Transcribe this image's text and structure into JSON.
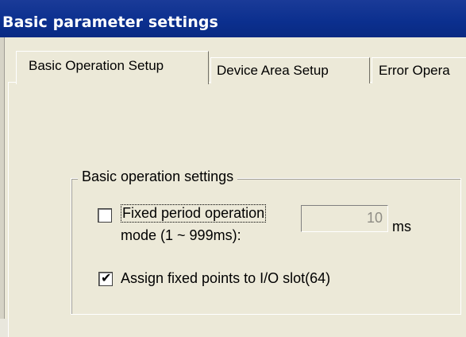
{
  "window": {
    "title": "Basic parameter settings"
  },
  "tabs": [
    {
      "label": "Basic Operation Setup",
      "active": true
    },
    {
      "label": "Device Area Setup",
      "active": false
    },
    {
      "label": "Error Opera",
      "active": false
    }
  ],
  "group": {
    "caption": "Basic operation settings",
    "fixed_period": {
      "checked": false,
      "label_line1": "Fixed period operation",
      "label_line2": "mode (1 ~ 999ms):",
      "value": "10",
      "unit": "ms"
    },
    "assign_fixed": {
      "checked": true,
      "check_glyph": "✔",
      "label": "Assign fixed points to I/O slot(64)"
    }
  },
  "colors": {
    "titlebar": "#0b2f8e",
    "face": "#ece9d8",
    "disabled_text": "#8f8d85"
  }
}
